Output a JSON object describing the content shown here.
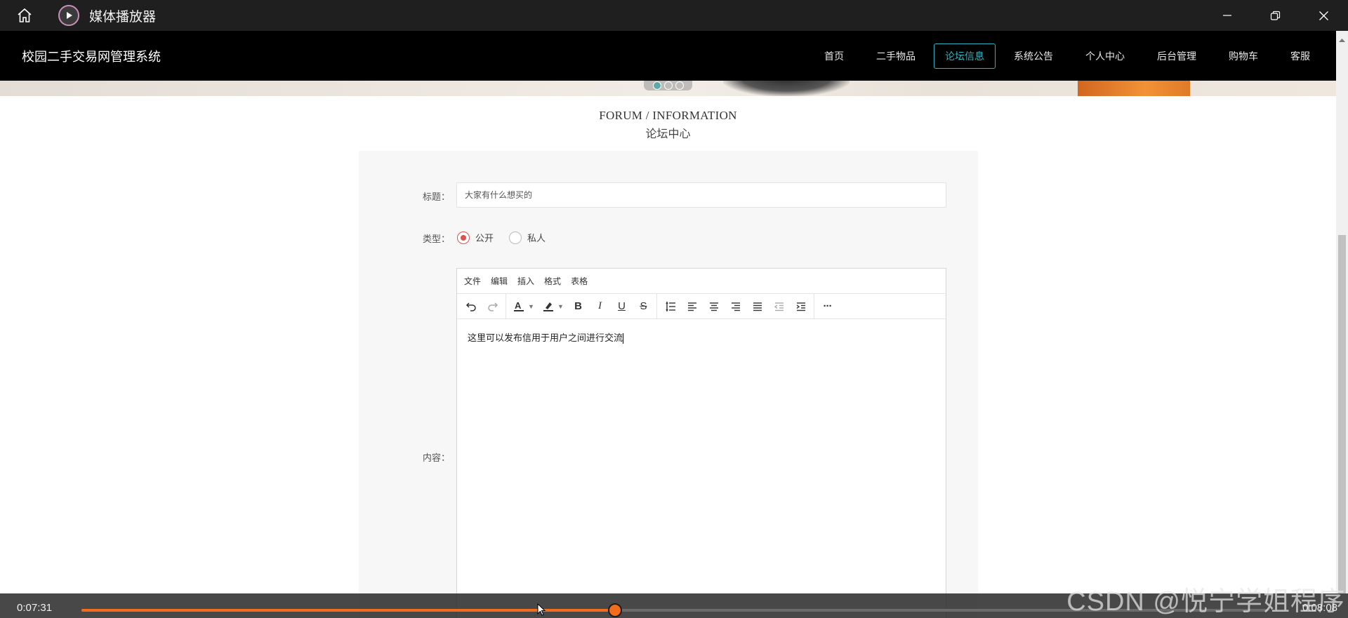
{
  "player": {
    "app_title": "媒体播放器",
    "current_time": "0:07:31",
    "total_time": "0:08:08",
    "progress": 0.4497,
    "accent": "#f26c1d"
  },
  "site": {
    "title": "校园二手交易网管理系统",
    "nav": [
      {
        "label": "首页",
        "active": false
      },
      {
        "label": "二手物品",
        "active": false
      },
      {
        "label": "论坛信息",
        "active": true
      },
      {
        "label": "系统公告",
        "active": false
      },
      {
        "label": "个人中心",
        "active": false
      },
      {
        "label": "后台管理",
        "active": false
      },
      {
        "label": "购物车",
        "active": false
      },
      {
        "label": "客服",
        "active": false
      }
    ],
    "active_color": "#2fb3c0"
  },
  "section": {
    "en": "FORUM / INFORMATION",
    "cn": "论坛中心"
  },
  "form": {
    "title_label": "标题：",
    "title_value": "大家有什么想买的",
    "type_label": "类型：",
    "type_options": [
      {
        "label": "公开",
        "checked": true
      },
      {
        "label": "私人",
        "checked": false
      }
    ],
    "content_label": "内容：",
    "editor_menu": [
      "文件",
      "编辑",
      "插入",
      "格式",
      "表格"
    ],
    "editor_text": "这里可以发布信用于用户之间进行交流"
  },
  "watermark": "CSDN @悦宁学姐程序"
}
